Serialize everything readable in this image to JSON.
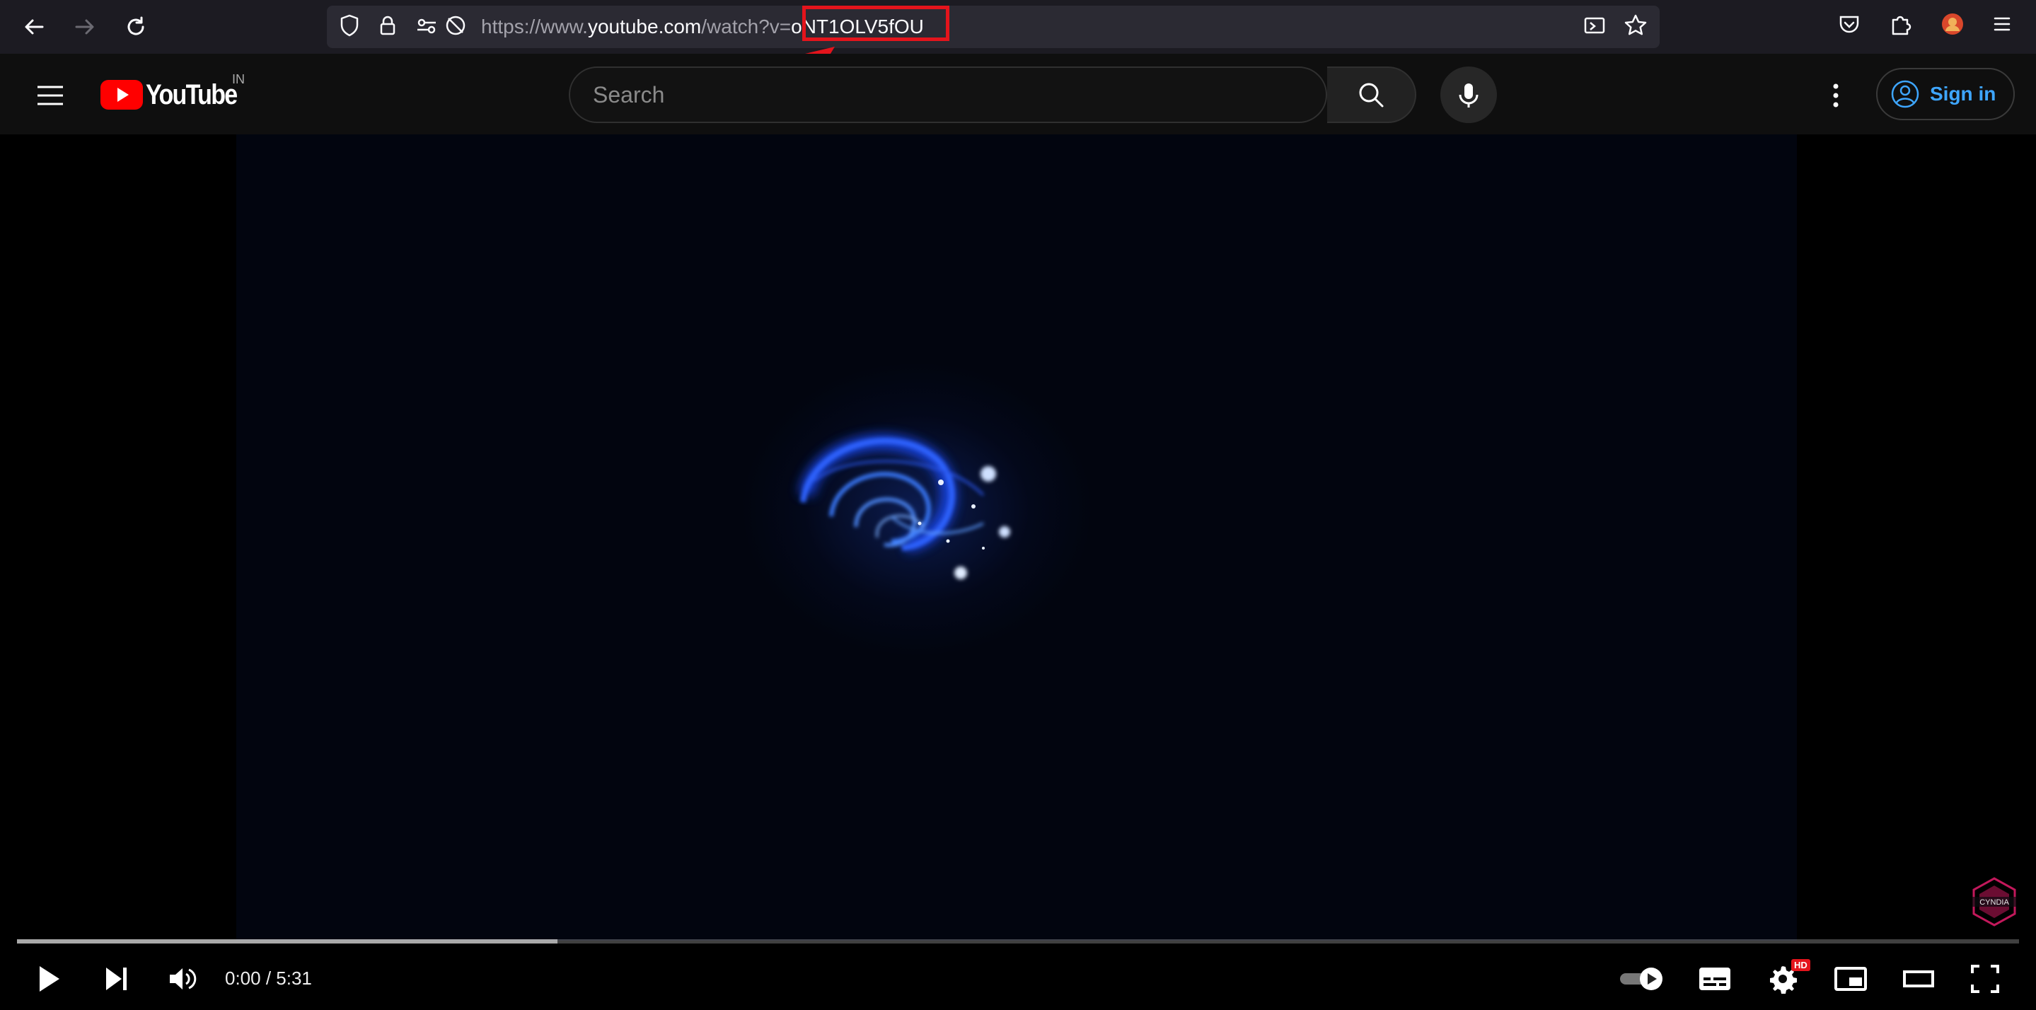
{
  "browser": {
    "url_prefix": "https://www.",
    "url_host": "youtube.com",
    "url_path": "/watch?v=",
    "video_id": "oNT1OLV5fOU",
    "annotation_color": "#e4141c"
  },
  "youtube": {
    "logo_text": "YouTube",
    "country_code": "IN",
    "search_placeholder": "Search",
    "signin_label": "Sign in",
    "accent_color": "#3ea6ff"
  },
  "player": {
    "time_display": "0:00 / 5:31",
    "hd_badge": "HD",
    "buffered_fraction": 0.27,
    "watermark_text": "CYNDIA"
  },
  "icons": {
    "browser": [
      "back-arrow-icon",
      "forward-arrow-icon",
      "reload-icon",
      "shield-icon",
      "lock-icon",
      "permissions-icon",
      "tracking-off-icon",
      "reader-view-icon",
      "bookmark-star-icon",
      "pocket-icon",
      "extensions-icon",
      "profile-avatar-icon",
      "menu-icon"
    ],
    "player": [
      "play-icon",
      "next-icon",
      "volume-icon",
      "autoplay-toggle-icon",
      "subtitles-icon",
      "settings-gear-icon",
      "miniplayer-icon",
      "theater-mode-icon",
      "fullscreen-icon"
    ]
  }
}
